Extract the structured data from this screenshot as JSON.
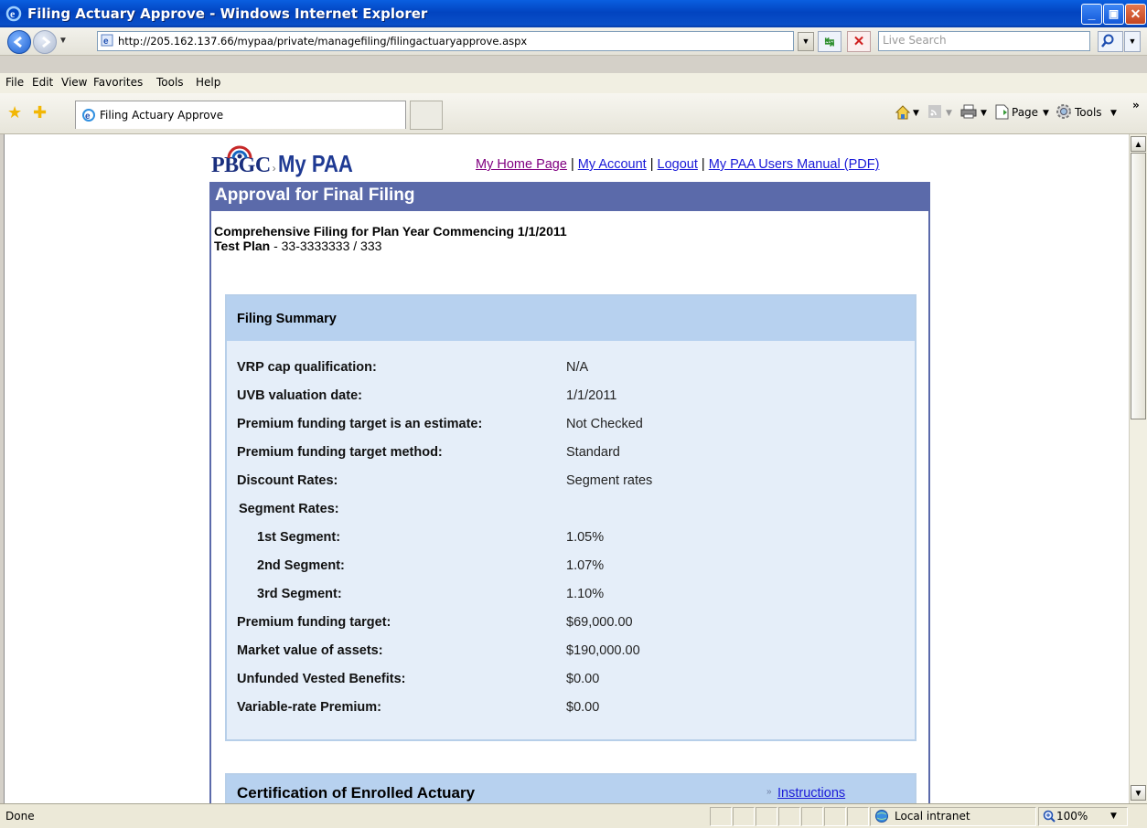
{
  "window": {
    "title": "Filing Actuary Approve - Windows Internet Explorer",
    "minimize": "_",
    "maximize": "▣",
    "close": "✕"
  },
  "address": {
    "url": "http://205.162.137.66/mypaa/private/managefiling/filingactuaryapprove.aspx"
  },
  "search": {
    "placeholder": "Live Search"
  },
  "menu": {
    "items": [
      "File",
      "Edit",
      "View",
      "Favorites",
      "Tools",
      "Help"
    ]
  },
  "tabs": {
    "active_label": "Filing Actuary Approve"
  },
  "command_bar": {
    "page": "Page",
    "tools": "Tools"
  },
  "header": {
    "logo_pbgc": "PBGC",
    "logo_mypaa": "My PAA",
    "links": [
      "My Home Page",
      "My Account",
      "Logout",
      "My PAA Users Manual (PDF)"
    ],
    "separator": " | "
  },
  "page": {
    "title": "Approval for Final Filing",
    "subtitle": "Comprehensive Filing for Plan Year Commencing 1/1/2011",
    "plan_name": "Test Plan",
    "plan_id": " - 33-3333333 / 333"
  },
  "summary": {
    "heading": "Filing Summary",
    "rows": [
      {
        "label": "VRP cap qualification:",
        "value": "N/A"
      },
      {
        "label": "UVB valuation date:",
        "value": "1/1/2011"
      },
      {
        "label": "Premium funding target is an estimate:",
        "value": "Not Checked"
      },
      {
        "label": "Premium funding target method:",
        "value": "Standard"
      },
      {
        "label": "Discount Rates:",
        "value": "Segment rates"
      },
      {
        "label": "Segment Rates:",
        "value": ""
      },
      {
        "label": "1st Segment:",
        "value": "1.05%"
      },
      {
        "label": "2nd Segment:",
        "value": "1.07%"
      },
      {
        "label": "3rd Segment:",
        "value": "1.10%"
      },
      {
        "label": "Premium funding target:",
        "value": "$69,000.00"
      },
      {
        "label": "Market value of assets:",
        "value": "$190,000.00"
      },
      {
        "label": "Unfunded Vested Benefits:",
        "value": "$0.00"
      },
      {
        "label": "Variable-rate Premium:",
        "value": "$0.00"
      }
    ]
  },
  "certification": {
    "heading": "Certification of Enrolled Actuary",
    "instructions_link": "Instructions"
  },
  "status": {
    "text": "Done",
    "zone": "Local intranet",
    "zoom": "100%"
  }
}
